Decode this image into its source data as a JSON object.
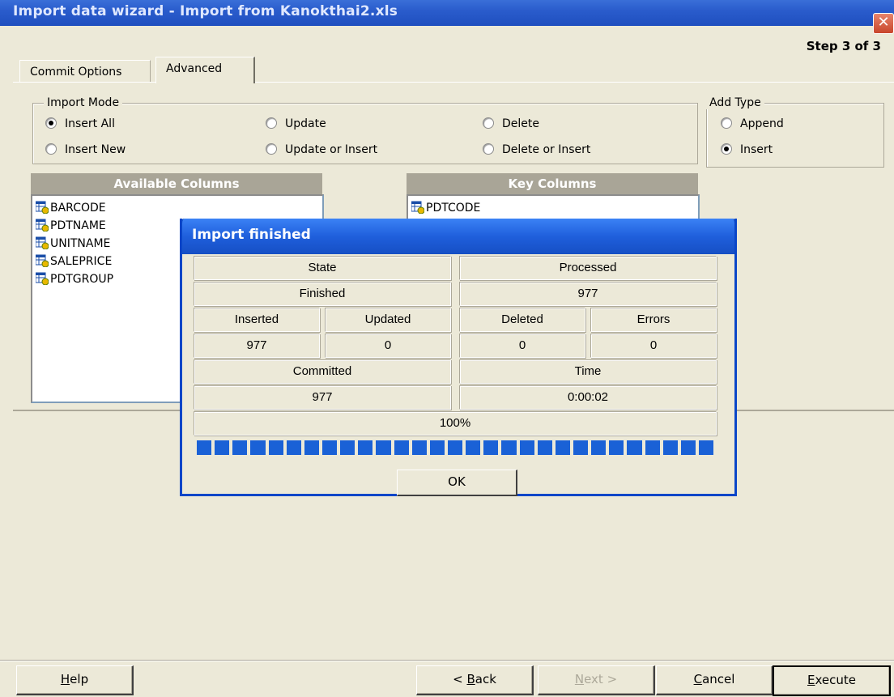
{
  "window": {
    "title": "Import data wizard - Import from Kanokthai2.xls",
    "step": "Step 3 of 3",
    "close_symbol": "✕"
  },
  "tabs": [
    {
      "label": "Commit Options"
    },
    {
      "label": "Advanced"
    }
  ],
  "import_mode": {
    "legend": "Import Mode",
    "options": [
      {
        "label": "Insert All",
        "selected": true
      },
      {
        "label": "Update",
        "selected": false
      },
      {
        "label": "Delete",
        "selected": false
      },
      {
        "label": "Insert New",
        "selected": false
      },
      {
        "label": "Update or Insert",
        "selected": false
      },
      {
        "label": "Delete or Insert",
        "selected": false
      }
    ]
  },
  "add_type": {
    "legend": "Add Type",
    "options": [
      {
        "label": "Append",
        "selected": false
      },
      {
        "label": "Insert",
        "selected": true
      }
    ]
  },
  "available_columns": {
    "header": "Available Columns",
    "items": [
      "BARCODE",
      "PDTNAME",
      "UNITNAME",
      "SALEPRICE",
      "PDTGROUP"
    ]
  },
  "key_columns": {
    "header": "Key Columns",
    "items": [
      "PDTCODE"
    ]
  },
  "dialog": {
    "title": "Import finished",
    "state_label": "State",
    "state_value": "Finished",
    "processed_label": "Processed",
    "processed_value": "977",
    "inserted_label": "Inserted",
    "inserted_value": "977",
    "updated_label": "Updated",
    "updated_value": "0",
    "deleted_label": "Deleted",
    "deleted_value": "0",
    "errors_label": "Errors",
    "errors_value": "0",
    "committed_label": "Committed",
    "committed_value": "977",
    "time_label": "Time",
    "time_value": "0:00:02",
    "progress_text": "100%",
    "progress_fraction": 1.0,
    "ok_label": "OK"
  },
  "buttons": {
    "help": {
      "mnemonic": "H",
      "rest": "elp"
    },
    "back": {
      "prefix": "< ",
      "mnemonic": "B",
      "rest": "ack"
    },
    "next": {
      "mnemonic": "N",
      "rest": "ext >"
    },
    "cancel": {
      "mnemonic": "C",
      "rest": "ancel"
    },
    "execute": {
      "mnemonic": "E",
      "rest": "xecute"
    }
  },
  "colors": {
    "titlebar": "#2a5ccc",
    "dialog_border": "#0a46c8",
    "progress": "#1a61d6"
  }
}
